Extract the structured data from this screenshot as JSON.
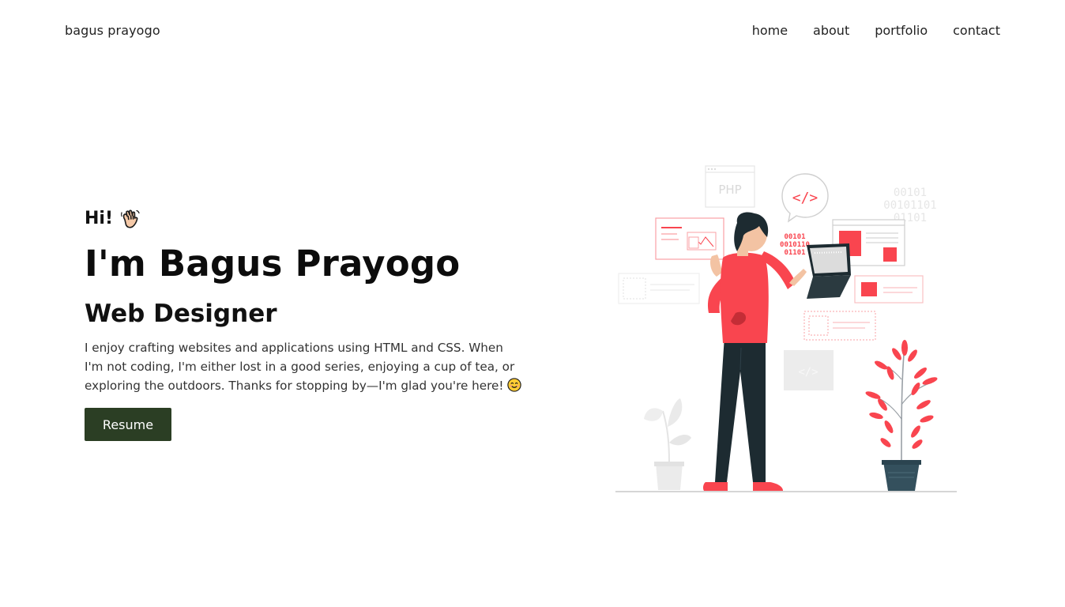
{
  "nav": {
    "brand": "bagus prayogo",
    "items": [
      {
        "label": "home"
      },
      {
        "label": "about"
      },
      {
        "label": "portfolio"
      },
      {
        "label": "contact"
      }
    ]
  },
  "hero": {
    "greeting": "Hi!",
    "greeting_icon": "waving-hand-icon",
    "name": "I'm Bagus Prayogo",
    "role": "Web Designer",
    "bio": "I enjoy crafting websites and applications using HTML and CSS. When I'm not coding, I'm either lost in a good series, enjoying a cup of tea, or exploring the outdoors. Thanks for stopping by—I'm glad you're here!",
    "bio_icon": "smiling-face-icon",
    "resume_label": "Resume"
  },
  "illustration": {
    "php_label": "PHP",
    "binary_right": [
      "00101",
      "00101101",
      "01101"
    ],
    "binary_left": [
      "00101",
      "0010110",
      "01101"
    ],
    "code_symbol": "</>"
  },
  "colors": {
    "accent": "#f9454f",
    "button": "#2b3e24",
    "dark": "#1d2b31",
    "text": "#111111"
  }
}
